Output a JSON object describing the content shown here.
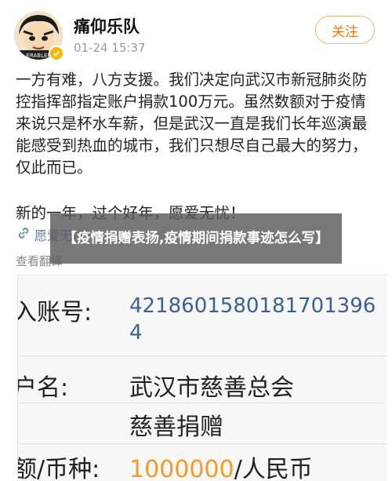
{
  "post": {
    "username": "痛仰乐队",
    "timestamp": "01-24 15:37",
    "follow_label": "关注",
    "avatar_text": "ERABLEF",
    "body_lines": [
      "一方有难，八方支援。我们决定向武汉市新冠肺炎防",
      "控指挥部指定账户捐款100万元。虽然数额对于疫情",
      "来说只是杯水车薪，但是武汉一直是我们长年巡演最",
      "能感受到热血的城市，我们只想尽自己最大的努力，",
      "仅此而已。"
    ],
    "closing": "新的一年，过个好年，愿爱无忧！",
    "tag": "愿爱无忧",
    "see_translation": "查看翻译"
  },
  "overlay": {
    "title": "【疫情捐赠表扬,疫情期间捐款事迹怎么写】"
  },
  "receipt": {
    "account_label": "入账号:",
    "account_value_1": "4218601580181701396",
    "account_value_2": "4",
    "name_label": "户名:",
    "name_value": "武汉市慈善总会",
    "purpose_value": "慈善捐赠",
    "amount_label": "额/币种:",
    "amount_value": "1000000",
    "currency_value": "/人民币"
  },
  "colors": {
    "follow_text": "#f07a1a",
    "follow_border": "#f4b37a",
    "link_blue": "#5b7ca8",
    "account_blue": "#3a5f9a",
    "amount_orange": "#f39a2a",
    "verify_gold": "#f5b800"
  },
  "icons": {
    "tag_icon": "link-icon",
    "verify_icon": "verified-badge-icon"
  }
}
